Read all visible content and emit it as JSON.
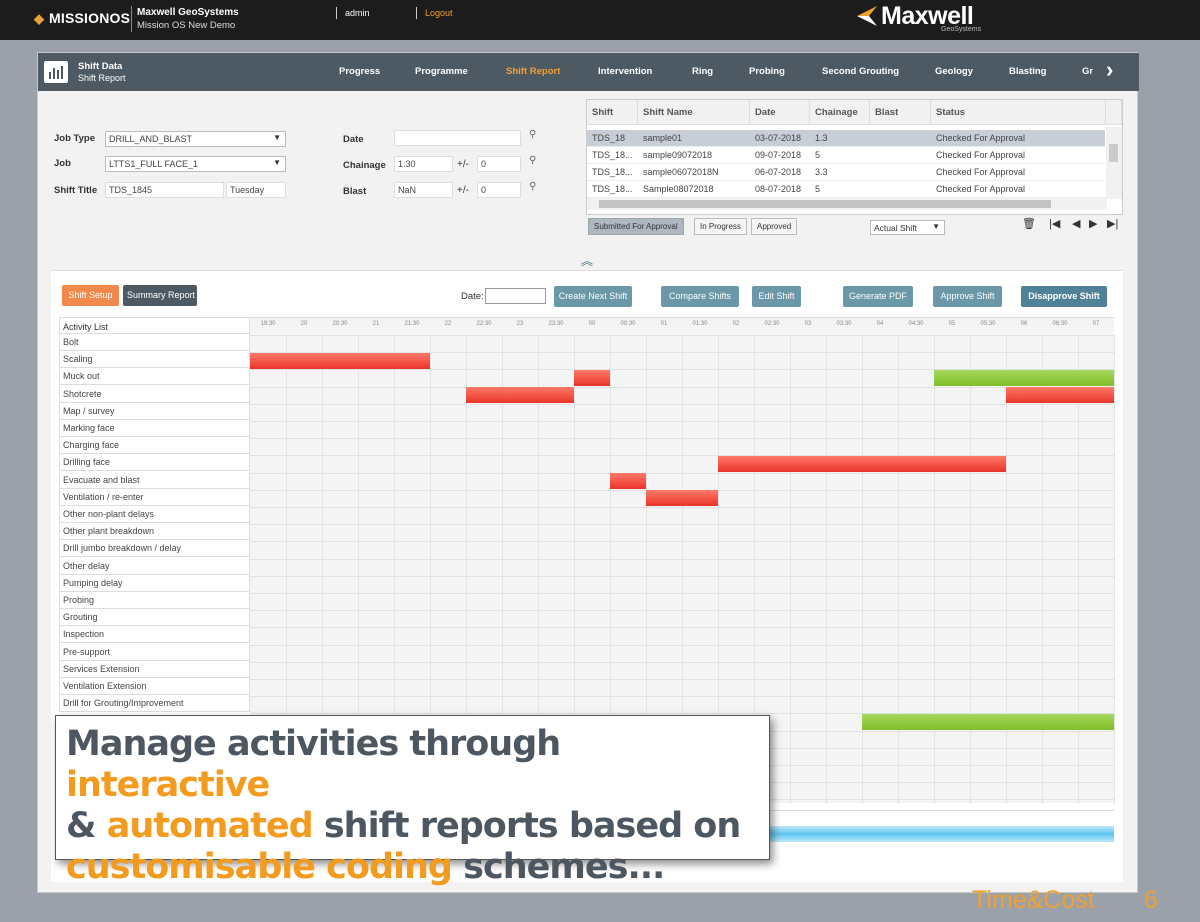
{
  "topbar": {
    "logo": "MISSIONOS",
    "company": "Maxwell GeoSystems",
    "project": "Mission OS New Demo",
    "user": "admin",
    "logout": "Logout",
    "brand": "Maxwell",
    "brand_sub": "GeoSystems"
  },
  "nav": {
    "title": "Shift Data",
    "subtitle": "Shift Report",
    "tabs": [
      "Progress",
      "Programme",
      "Shift Report",
      "Intervention",
      "Ring",
      "Probing",
      "Second Grouting",
      "Geology",
      "Blasting",
      "Gr"
    ],
    "active_tab": "Shift Report"
  },
  "form": {
    "job_type_label": "Job Type",
    "job_type_value": "DRILL_AND_BLAST",
    "job_label": "Job",
    "job_value": "LTTS1_FULL FACE_1",
    "shift_title_label": "Shift Title",
    "shift_title_value": "TDS_1845",
    "shift_day": "Tuesday",
    "date_label": "Date",
    "date_value": "",
    "chainage_label": "Chainage",
    "chainage_value": "1.30",
    "chainage_pm": "+/-",
    "chainage_tol": "0",
    "blast_label": "Blast",
    "blast_value": "NaN",
    "blast_pm": "+/-",
    "blast_tol": "0"
  },
  "shift_table": {
    "headers": [
      "Shift",
      "Shift Name",
      "Date",
      "Chainage",
      "Blast",
      "Status"
    ],
    "rows": [
      [
        "TDS_18",
        "sample01",
        "03-07-2018",
        "1.3",
        "",
        "Checked For Approval"
      ],
      [
        "TDS_18...",
        "sample09072018",
        "09-07-2018",
        "5",
        "",
        "Checked For Approval"
      ],
      [
        "TDS_18...",
        "sample06072018N",
        "06-07-2018",
        "3.3",
        "",
        "Checked For Approval"
      ],
      [
        "TDS_18...",
        "Sample08072018",
        "08-07-2018",
        "5",
        "",
        "Checked For Approval"
      ]
    ],
    "status_buttons": [
      "Submitted For Approval",
      "In Progress",
      "Approved"
    ],
    "actual_shift": "Actual Shift"
  },
  "toolbar": {
    "shift_setup": "Shift Setup",
    "summary_report": "Summary Report",
    "date_label": "Date:",
    "date_value": "",
    "create_next": "Create Next Shift",
    "compare": "Compare Shifts",
    "edit": "Edit Shift",
    "generate_pdf": "Generate PDF",
    "approve": "Approve Shift",
    "disapprove": "Disapprove Shift"
  },
  "gantt": {
    "header": "Activity List",
    "ticks": [
      "19:30",
      "20",
      "20:30",
      "21",
      "21:30",
      "22",
      "22:30",
      "23",
      "23:30",
      "00",
      "00:30",
      "01",
      "01:30",
      "02",
      "02:30",
      "03",
      "03:30",
      "04",
      "04:30",
      "05",
      "05:30",
      "06",
      "06:30",
      "07"
    ],
    "activities": [
      "Bolt",
      "Scaling",
      "Muck out",
      "Shotcrete",
      "Map / survey",
      "Marking face",
      "Charging face",
      "Drilling face",
      "Evacuate and blast",
      "Ventilation / re-enter",
      "Other non-plant delays",
      "Other plant breakdown",
      "Drill jumbo breakdown / delay",
      "Other delay",
      "Pumping delay",
      "Probing",
      "Grouting",
      "Inspection",
      "Pre-support",
      "Services Extension",
      "Ventilation Extension",
      "Drill for Grouting/Improvement"
    ],
    "bars": [
      {
        "row": 1,
        "start": 19.0,
        "end": 21.5,
        "color": "red"
      },
      {
        "row": 2,
        "start": 23.5,
        "end": 24.0,
        "color": "red"
      },
      {
        "row": 2,
        "start": 28.5,
        "end": 31.0,
        "color": "green"
      },
      {
        "row": 3,
        "start": 22.0,
        "end": 23.5,
        "color": "red"
      },
      {
        "row": 3,
        "start": 29.5,
        "end": 31.0,
        "color": "red"
      },
      {
        "row": 7,
        "start": 25.5,
        "end": 29.5,
        "color": "red"
      },
      {
        "row": 8,
        "start": 24.0,
        "end": 24.5,
        "color": "red"
      },
      {
        "row": 9,
        "start": 24.5,
        "end": 25.5,
        "color": "red"
      },
      {
        "row": 22,
        "start": 27.5,
        "end": 31.0,
        "color": "green"
      }
    ]
  },
  "caption": {
    "part1": "Manage activities through ",
    "hl1": "interactive",
    "part2": "& ",
    "hl2": "automated",
    "part3": " shift reports based on",
    "hl3": "customisable coding",
    "part4": " schemes..."
  },
  "footer": {
    "tag": "Time&Cost",
    "page": "6"
  }
}
